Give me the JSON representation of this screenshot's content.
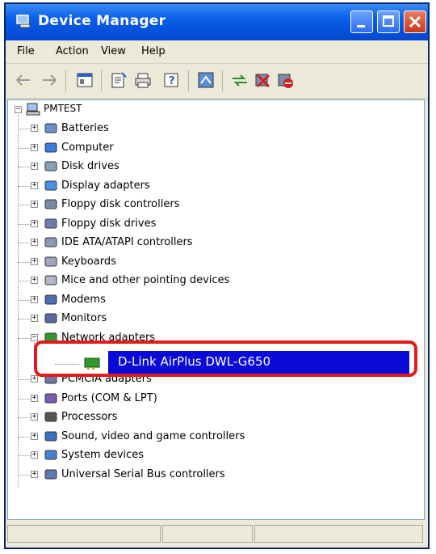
{
  "window": {
    "title": "Device Manager"
  },
  "menu": {
    "items": [
      "File",
      "Action",
      "View",
      "Help"
    ]
  },
  "toolbar": {
    "icons": [
      "back-icon",
      "forward-icon",
      "console-icon",
      "properties-icon",
      "print-icon",
      "help-icon",
      "scan-icon",
      "update-driver-icon",
      "uninstall-icon",
      "disable-icon"
    ]
  },
  "tree": {
    "root": "PMTEST",
    "categories": [
      "Batteries",
      "Computer",
      "Disk drives",
      "Display adapters",
      "Floppy disk controllers",
      "Floppy disk drives",
      "IDE ATA/ATAPI controllers",
      "Keyboards",
      "Mice and other pointing devices",
      "Modems",
      "Monitors",
      "Network adapters",
      "PCMCIA adapters",
      "Ports (COM & LPT)",
      "Processors",
      "Sound, video and game controllers",
      "System devices",
      "Universal Serial Bus controllers"
    ],
    "selected_device": "D-Link AirPlus DWL-G650"
  },
  "colors": {
    "selection": "#0a0ad8",
    "highlight": "#e21b1b",
    "titlebar": "#0a5ee8"
  }
}
